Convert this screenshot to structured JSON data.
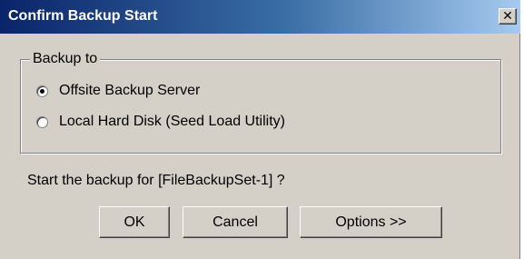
{
  "dialog": {
    "title": "Confirm Backup Start",
    "close_glyph": "✕"
  },
  "backup_group": {
    "legend": "Backup to",
    "options": [
      {
        "label": "Offsite Backup Server",
        "selected": true
      },
      {
        "label": "Local Hard Disk (Seed Load Utility)",
        "selected": false
      }
    ]
  },
  "prompt": "Start the backup for [FileBackupSet-1] ?",
  "buttons": {
    "ok": "OK",
    "cancel": "Cancel",
    "options": "Options >>"
  },
  "colors": {
    "title_bar_start": "#0a246a",
    "title_bar_end": "#a6caf0",
    "dialog_face": "#d4d0c8"
  }
}
